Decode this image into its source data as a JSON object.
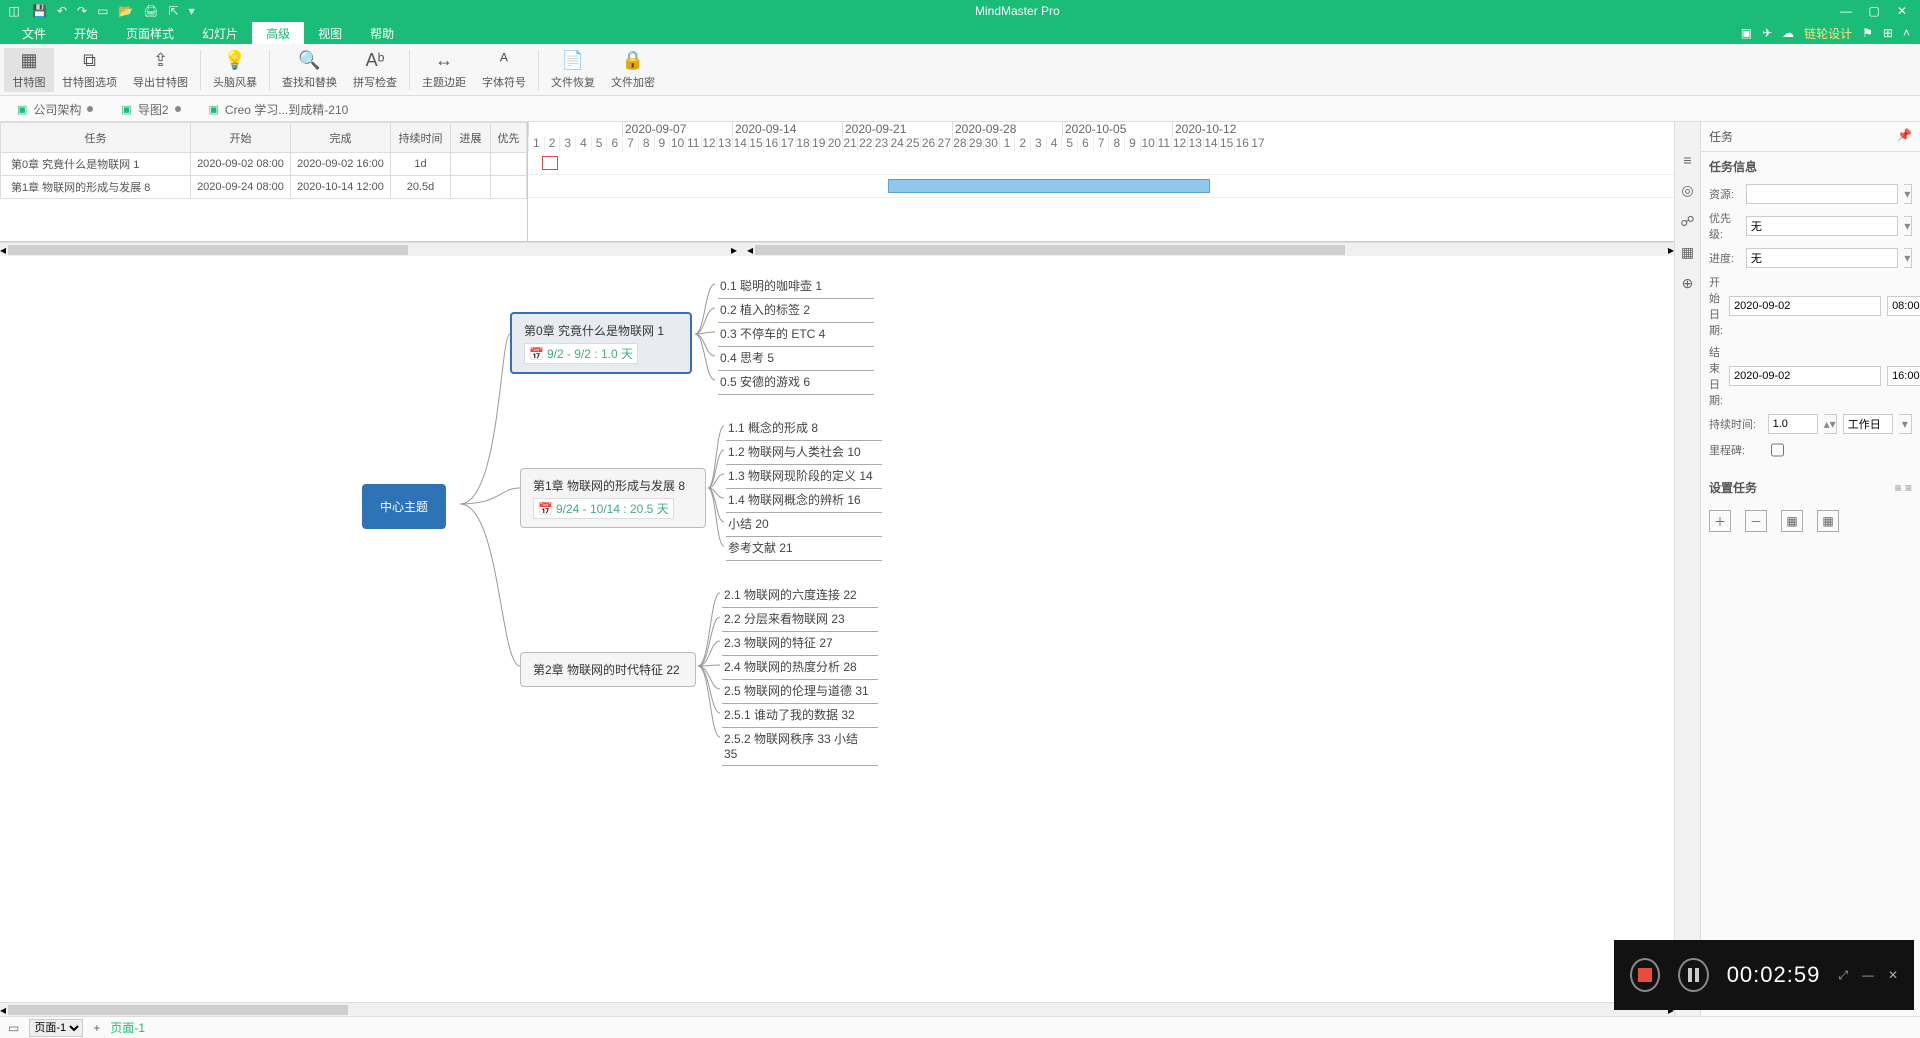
{
  "app": {
    "title": "MindMaster Pro"
  },
  "qat_icons": [
    "save",
    "undo",
    "redo",
    "new",
    "open",
    "print",
    "export",
    "more"
  ],
  "menu": {
    "items": [
      "文件",
      "开始",
      "页面样式",
      "幻灯片",
      "高级",
      "视图",
      "帮助"
    ],
    "active_index": 4,
    "right_label": "链轮设计"
  },
  "ribbon": [
    {
      "icon": "▦",
      "label": "甘特图",
      "active": true
    },
    {
      "icon": "⧉",
      "label": "甘特图选项"
    },
    {
      "icon": "⇪",
      "label": "导出甘特图"
    },
    {
      "sep": true
    },
    {
      "icon": "💡",
      "label": "头脑风暴"
    },
    {
      "sep": true
    },
    {
      "icon": "🔍",
      "label": "查找和替换"
    },
    {
      "icon": "Aᵇ",
      "label": "拼写检查"
    },
    {
      "sep": true
    },
    {
      "icon": "↔",
      "label": "主题边距"
    },
    {
      "icon": "ᴬ",
      "label": "字体符号"
    },
    {
      "sep": true
    },
    {
      "icon": "📄",
      "label": "文件恢复"
    },
    {
      "icon": "🔒",
      "label": "文件加密"
    }
  ],
  "tabs": [
    {
      "label": "公司架构",
      "dirty": true
    },
    {
      "label": "导图2",
      "dirty": true,
      "active": true
    },
    {
      "label": "Creo 学习...到成精-210",
      "dirty": false
    }
  ],
  "gantt": {
    "columns": [
      "任务",
      "开始",
      "完成",
      "持续时间",
      "进展",
      "优先"
    ],
    "rows": [
      {
        "task": "第0章 究竟什么是物联网 1",
        "start": "2020-09-02 08:00",
        "end": "2020-09-02 16:00",
        "dur": "1d",
        "prog": "",
        "pri": ""
      },
      {
        "task": "第1章 物联网的形成与发展 8",
        "start": "2020-09-24 08:00",
        "end": "2020-10-14 12:00",
        "dur": "20.5d",
        "prog": "",
        "pri": ""
      }
    ],
    "weeks": [
      "2020-09-07",
      "2020-09-14",
      "2020-09-21",
      "2020-09-28",
      "2020-10-05",
      "2020-10-12"
    ],
    "days": [
      1,
      2,
      3,
      4,
      5,
      6,
      7,
      8,
      9,
      10,
      11,
      12,
      13,
      14,
      15,
      16,
      17,
      18,
      19,
      20,
      21,
      22,
      23,
      24,
      25,
      26,
      27,
      28,
      29,
      30,
      1,
      2,
      3,
      4,
      5,
      6,
      7,
      8,
      9,
      10,
      11,
      12,
      13,
      14,
      15,
      16,
      17
    ]
  },
  "mindmap": {
    "center": "中心主题",
    "branches": [
      {
        "title": "第0章 究竟什么是物联网 1",
        "date": "9/2 - 9/2 : 1.0 天",
        "selected": true,
        "leaves": [
          "0.1 聪明的咖啡壶 1",
          "0.2 植入的标签 2",
          "0.3 不停车的 ETC 4",
          "0.4 思考 5",
          "0.5 安德的游戏 6"
        ]
      },
      {
        "title": "第1章 物联网的形成与发展 8",
        "date": "9/24 - 10/14 : 20.5 天",
        "leaves": [
          "1.1 概念的形成 8",
          "1.2 物联网与人类社会 10",
          "1.3 物联网现阶段的定义 14",
          "1.4 物联网概念的辨析 16",
          "小结 20",
          "参考文献 21"
        ]
      },
      {
        "title": "第2章 物联网的时代特征 22",
        "leaves": [
          "2.1 物联网的六度连接 22",
          "2.2 分层来看物联网 23",
          "2.3 物联网的特征 27",
          "2.4 物联网的热度分析 28",
          "2.5 物联网的伦理与道德 31",
          "2.5.1 谁动了我的数据 32",
          "2.5.2 物联网秩序 33 小结 35"
        ]
      }
    ]
  },
  "task_panel": {
    "title": "任务",
    "section1": "任务信息",
    "resource_label": "资源:",
    "resource": "",
    "priority_label": "优先级:",
    "priority": "无",
    "progress_label": "进度:",
    "progress": "无",
    "start_label": "开始日期:",
    "start_date": "2020-09-02",
    "start_time": "08:00",
    "end_label": "结束日期:",
    "end_date": "2020-09-02",
    "end_time": "16:00",
    "dur_label": "持续时间:",
    "dur_val": "1.0",
    "dur_unit": "工作日",
    "milestone_label": "里程碑:",
    "section2": "设置任务"
  },
  "statusbar": {
    "page_selector": "页面-1",
    "page_name": "页面-1",
    "plus": "+"
  },
  "recorder": {
    "time": "00:02:59"
  }
}
